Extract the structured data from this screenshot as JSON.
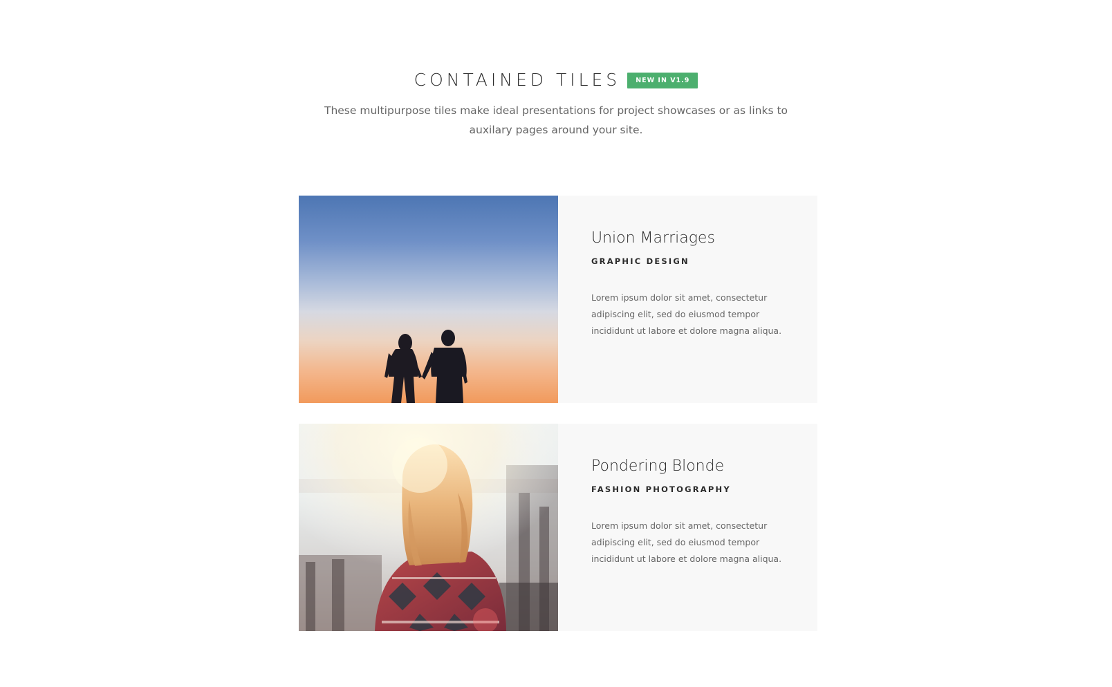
{
  "header": {
    "title": "CONTAINED TILES",
    "badge": "NEW IN V1.9",
    "lead": "These multipurpose tiles make ideal presentations for project showcases or as links to auxilary pages around your site."
  },
  "tiles": [
    {
      "title": "Union Marriages",
      "category": "GRAPHIC DESIGN",
      "description": "Lorem ipsum dolor sit amet, consectetur adipiscing elit, sed do eiusmod tempor incididunt ut labore et dolore magna aliqua.",
      "image": "couple-sunset-photo"
    },
    {
      "title": "Pondering Blonde",
      "category": "FASHION PHOTOGRAPHY",
      "description": "Lorem ipsum dolor sit amet, consectetur adipiscing elit, sed do eiusmod tempor incididunt ut labore et dolore magna aliqua.",
      "image": "blonde-woman-photo"
    }
  ],
  "colors": {
    "badge": "#4caf6e",
    "tile_background": "#f8f8f8",
    "heading": "#2b2b2b",
    "body_text": "#666666"
  }
}
